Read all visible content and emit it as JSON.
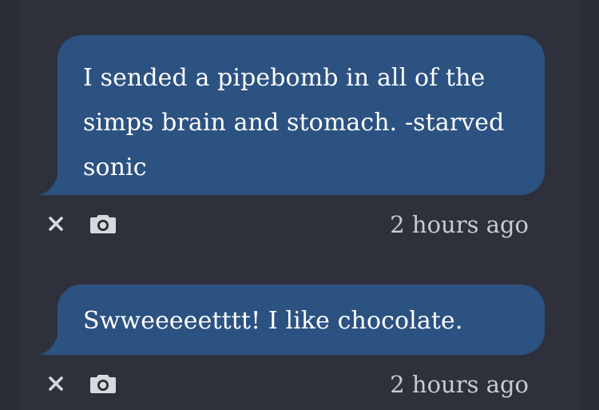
{
  "messages": [
    {
      "text": "I sended a pipebomb in all of the simps brain and stomach. -starved sonic",
      "timestamp": "2 hours ago"
    },
    {
      "text": "Swweeeeetttt! I like chocolate.",
      "timestamp": "2 hours ago"
    }
  ],
  "icons": {
    "delete": "close-icon",
    "screenshot": "camera-icon"
  },
  "colors": {
    "background": "#2a2d36",
    "panel": "#2e313b",
    "bubble": "#2c5282",
    "text": "#ffffff",
    "muted": "#c9cbd2"
  }
}
